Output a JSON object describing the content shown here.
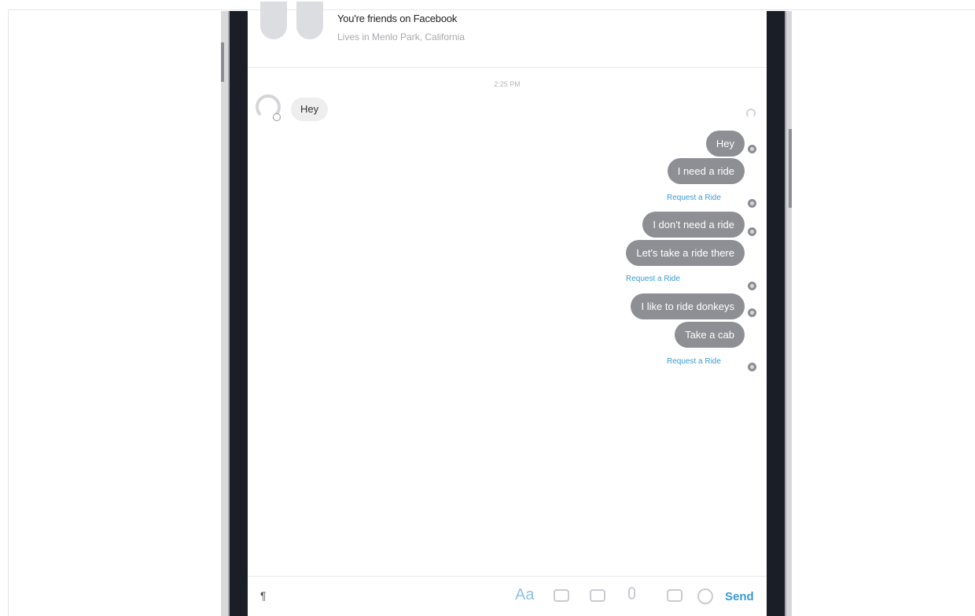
{
  "header": {
    "friends_text": "You're friends on Facebook",
    "location_text": "Lives in Menlo Park, California"
  },
  "conversation": {
    "timestamp": "2:25 PM",
    "incoming": [
      {
        "text": "Hey"
      }
    ],
    "outgoing": [
      {
        "text": "Hey"
      },
      {
        "text": "I need a ride",
        "link": "Request a Ride"
      },
      {
        "text": "I don't need a ride"
      },
      {
        "text": "Let's take a ride there",
        "link": "Request a Ride"
      },
      {
        "text": "I like to ride donkeys"
      },
      {
        "text": "Take a cab",
        "link": "Request a Ride"
      }
    ]
  },
  "composer": {
    "cursor_glyph": "¶",
    "aa_label": "Aa",
    "send_label": "Send",
    "icons": [
      "camera-icon",
      "gallery-icon",
      "microphone-icon",
      "gif-icon",
      "emoji-icon"
    ]
  },
  "colors": {
    "outgoing_bubble": "#8e8f95",
    "incoming_bubble": "#eeeeef",
    "link": "#3b9bd6",
    "phone_frame": "#1a1e27"
  }
}
